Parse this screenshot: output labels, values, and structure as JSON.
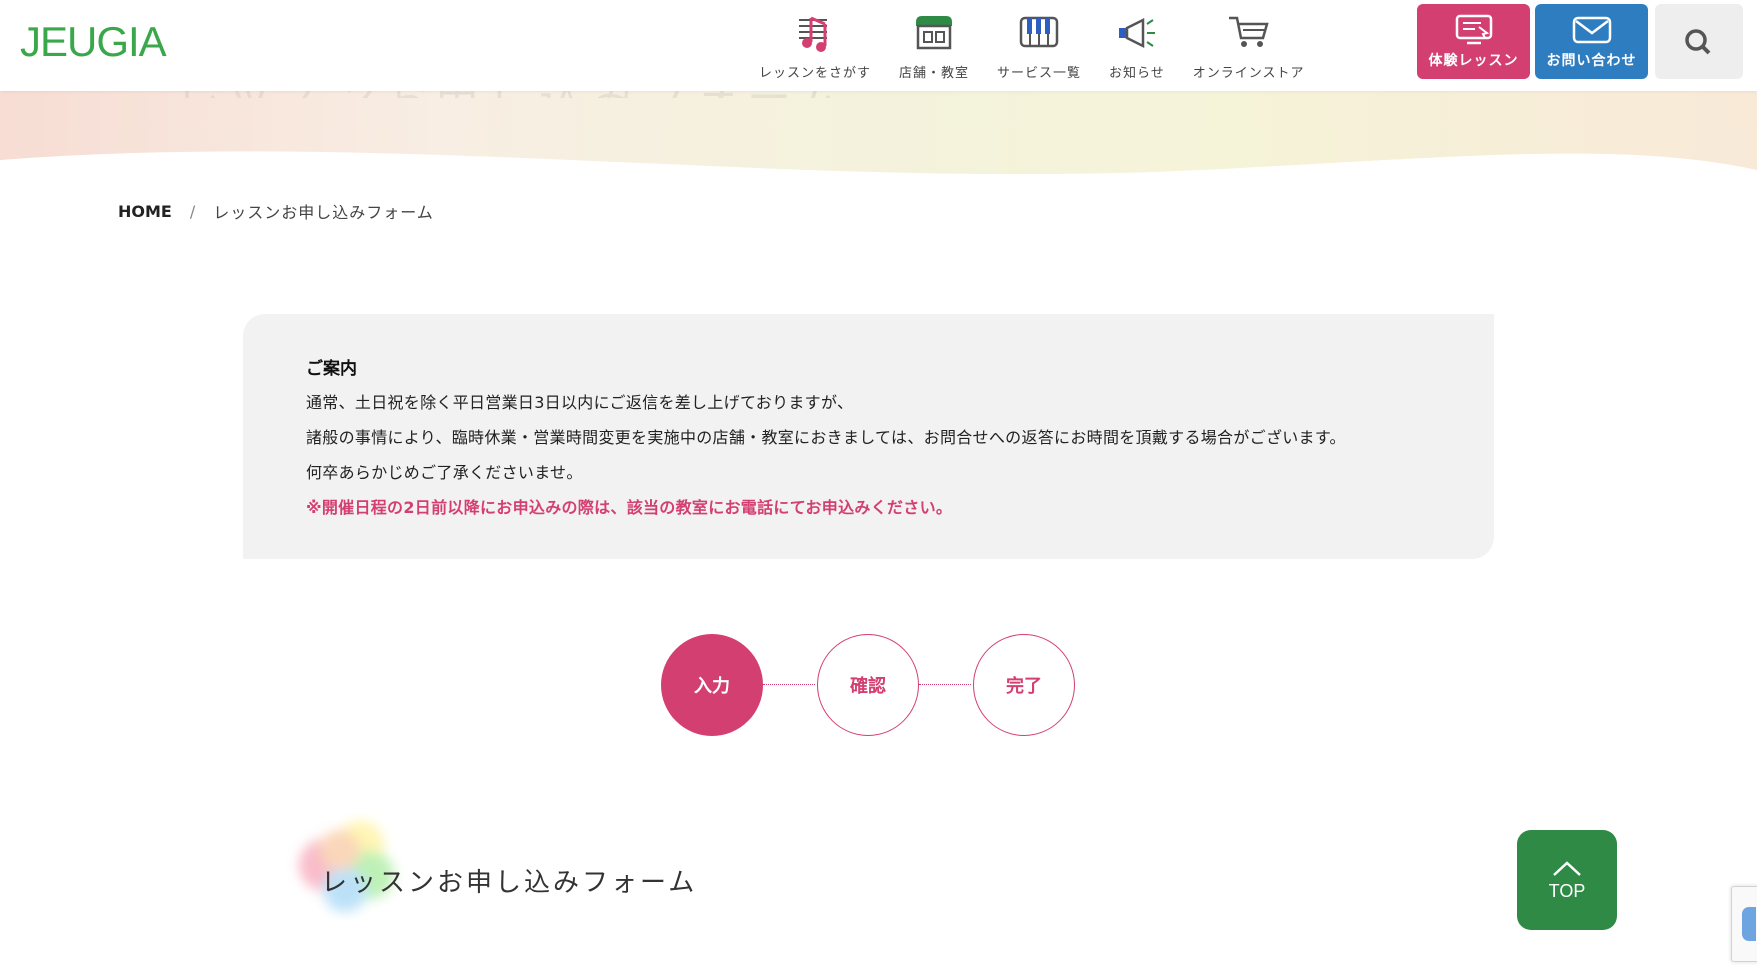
{
  "brand": {
    "logo_text": "JEUGIA",
    "logo_color": "#3aa84a"
  },
  "hero": {
    "ghost_text": "レッスンお申し込みフォーム"
  },
  "nav": {
    "items": [
      {
        "label": "レッスンをさがす",
        "icon": "music-note-icon"
      },
      {
        "label": "店舗・教室",
        "icon": "storefront-icon"
      },
      {
        "label": "サービス一覧",
        "icon": "piano-keys-icon"
      },
      {
        "label": "お知らせ",
        "icon": "megaphone-icon"
      },
      {
        "label": "オンラインストア",
        "icon": "shopping-cart-icon"
      }
    ]
  },
  "header_buttons": {
    "trial_label": "体験レッスン",
    "contact_label": "お問い合わせ",
    "trial_color": "#d43f72",
    "contact_color": "#2f7dc1"
  },
  "breadcrumb": {
    "home": "HOME",
    "separator": "/",
    "current": "レッスンお申し込みフォーム"
  },
  "notice": {
    "title": "ご案内",
    "lines": [
      "通常、土日祝を除く平日営業日3日以内にご返信を差し上げておりますが、",
      "諸般の事情により、臨時休業・営業時間変更を実施中の店舗・教室におきましては、お問合せへの返答にお時間を頂戴する場合がございます。",
      "何卒あらかじめご了承くださいませ。"
    ],
    "warning": "※開催日程の2日前以降にお申込みの際は、該当の教室にお電話にてお申込みください。"
  },
  "steps": {
    "items": [
      {
        "label": "入力",
        "active": true
      },
      {
        "label": "確認",
        "active": false
      },
      {
        "label": "完了",
        "active": false
      }
    ],
    "accent_color": "#d43f72"
  },
  "form": {
    "heading": "レッスンお申し込みフォーム"
  },
  "top_button": {
    "label": "TOP",
    "color": "#2f8a46"
  }
}
